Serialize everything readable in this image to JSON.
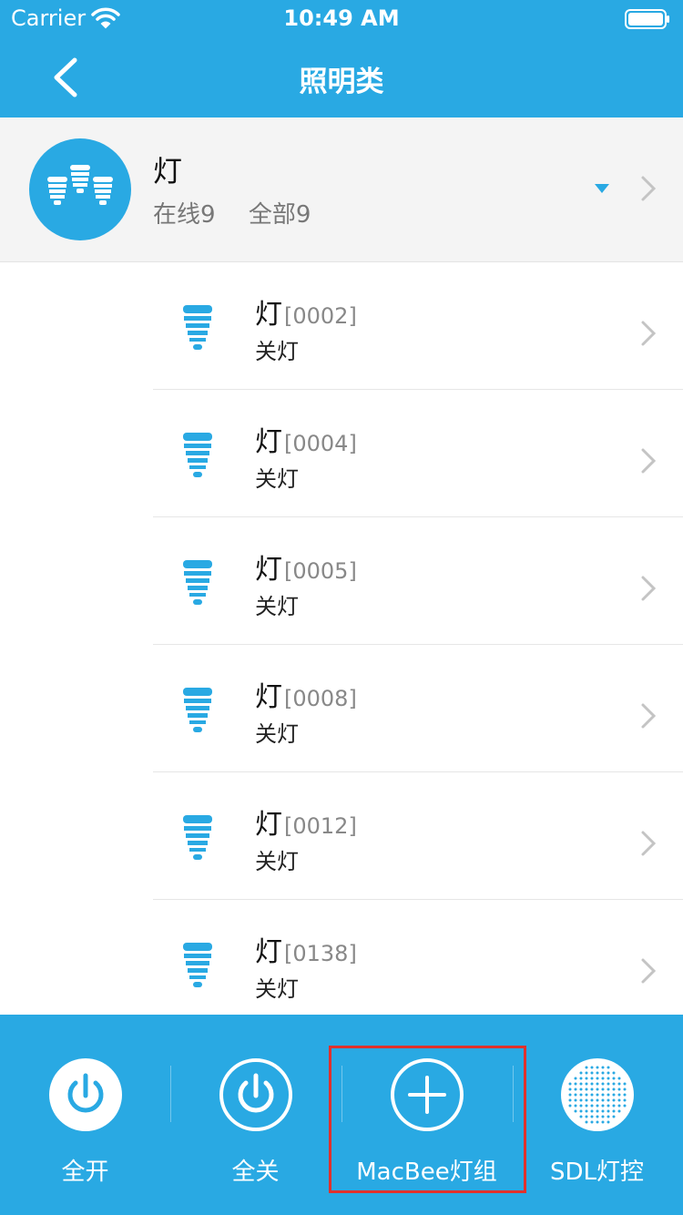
{
  "status_bar": {
    "carrier": "Carrier",
    "time": "10:49 AM"
  },
  "header": {
    "title": "照明类"
  },
  "group": {
    "name": "灯",
    "online": "在线9",
    "total": "全部9"
  },
  "devices": [
    {
      "name": "灯",
      "code": "[0002]",
      "state": "关灯"
    },
    {
      "name": "灯",
      "code": "[0004]",
      "state": "关灯"
    },
    {
      "name": "灯",
      "code": "[0005]",
      "state": "关灯"
    },
    {
      "name": "灯",
      "code": "[0008]",
      "state": "关灯"
    },
    {
      "name": "灯",
      "code": "[0012]",
      "state": "关灯"
    },
    {
      "name": "灯",
      "code": "[0138]",
      "state": "关灯"
    }
  ],
  "bottom_bar": {
    "all_on": "全开",
    "all_off": "全关",
    "macbee_group": "MacBee灯组",
    "sdl_control": "SDL灯控"
  },
  "colors": {
    "brand": "#29a9e3",
    "highlight": "#e0312d"
  }
}
